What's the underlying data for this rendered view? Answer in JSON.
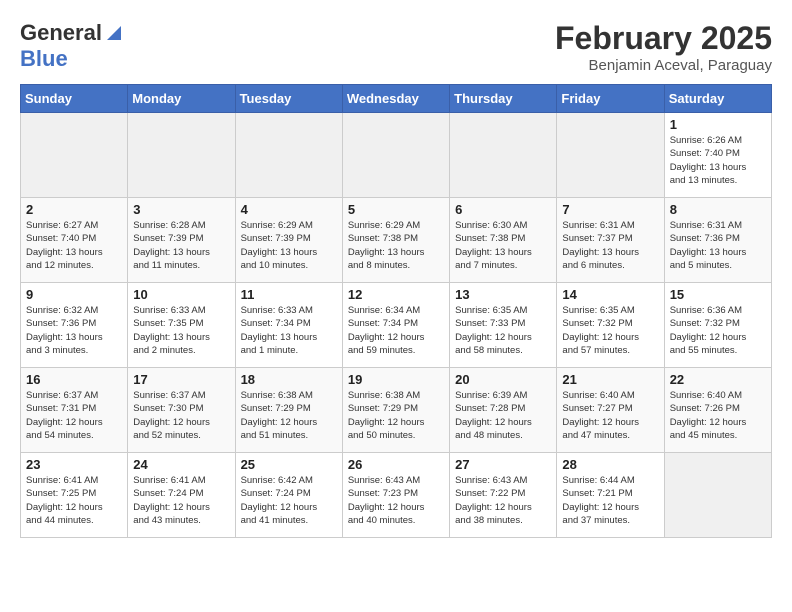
{
  "logo": {
    "general": "General",
    "blue": "Blue"
  },
  "title": {
    "month": "February 2025",
    "location": "Benjamin Aceval, Paraguay"
  },
  "days_of_week": [
    "Sunday",
    "Monday",
    "Tuesday",
    "Wednesday",
    "Thursday",
    "Friday",
    "Saturday"
  ],
  "weeks": [
    [
      {
        "day": "",
        "info": ""
      },
      {
        "day": "",
        "info": ""
      },
      {
        "day": "",
        "info": ""
      },
      {
        "day": "",
        "info": ""
      },
      {
        "day": "",
        "info": ""
      },
      {
        "day": "",
        "info": ""
      },
      {
        "day": "1",
        "info": "Sunrise: 6:26 AM\nSunset: 7:40 PM\nDaylight: 13 hours\nand 13 minutes."
      }
    ],
    [
      {
        "day": "2",
        "info": "Sunrise: 6:27 AM\nSunset: 7:40 PM\nDaylight: 13 hours\nand 12 minutes."
      },
      {
        "day": "3",
        "info": "Sunrise: 6:28 AM\nSunset: 7:39 PM\nDaylight: 13 hours\nand 11 minutes."
      },
      {
        "day": "4",
        "info": "Sunrise: 6:29 AM\nSunset: 7:39 PM\nDaylight: 13 hours\nand 10 minutes."
      },
      {
        "day": "5",
        "info": "Sunrise: 6:29 AM\nSunset: 7:38 PM\nDaylight: 13 hours\nand 8 minutes."
      },
      {
        "day": "6",
        "info": "Sunrise: 6:30 AM\nSunset: 7:38 PM\nDaylight: 13 hours\nand 7 minutes."
      },
      {
        "day": "7",
        "info": "Sunrise: 6:31 AM\nSunset: 7:37 PM\nDaylight: 13 hours\nand 6 minutes."
      },
      {
        "day": "8",
        "info": "Sunrise: 6:31 AM\nSunset: 7:36 PM\nDaylight: 13 hours\nand 5 minutes."
      }
    ],
    [
      {
        "day": "9",
        "info": "Sunrise: 6:32 AM\nSunset: 7:36 PM\nDaylight: 13 hours\nand 3 minutes."
      },
      {
        "day": "10",
        "info": "Sunrise: 6:33 AM\nSunset: 7:35 PM\nDaylight: 13 hours\nand 2 minutes."
      },
      {
        "day": "11",
        "info": "Sunrise: 6:33 AM\nSunset: 7:34 PM\nDaylight: 13 hours\nand 1 minute."
      },
      {
        "day": "12",
        "info": "Sunrise: 6:34 AM\nSunset: 7:34 PM\nDaylight: 12 hours\nand 59 minutes."
      },
      {
        "day": "13",
        "info": "Sunrise: 6:35 AM\nSunset: 7:33 PM\nDaylight: 12 hours\nand 58 minutes."
      },
      {
        "day": "14",
        "info": "Sunrise: 6:35 AM\nSunset: 7:32 PM\nDaylight: 12 hours\nand 57 minutes."
      },
      {
        "day": "15",
        "info": "Sunrise: 6:36 AM\nSunset: 7:32 PM\nDaylight: 12 hours\nand 55 minutes."
      }
    ],
    [
      {
        "day": "16",
        "info": "Sunrise: 6:37 AM\nSunset: 7:31 PM\nDaylight: 12 hours\nand 54 minutes."
      },
      {
        "day": "17",
        "info": "Sunrise: 6:37 AM\nSunset: 7:30 PM\nDaylight: 12 hours\nand 52 minutes."
      },
      {
        "day": "18",
        "info": "Sunrise: 6:38 AM\nSunset: 7:29 PM\nDaylight: 12 hours\nand 51 minutes."
      },
      {
        "day": "19",
        "info": "Sunrise: 6:38 AM\nSunset: 7:29 PM\nDaylight: 12 hours\nand 50 minutes."
      },
      {
        "day": "20",
        "info": "Sunrise: 6:39 AM\nSunset: 7:28 PM\nDaylight: 12 hours\nand 48 minutes."
      },
      {
        "day": "21",
        "info": "Sunrise: 6:40 AM\nSunset: 7:27 PM\nDaylight: 12 hours\nand 47 minutes."
      },
      {
        "day": "22",
        "info": "Sunrise: 6:40 AM\nSunset: 7:26 PM\nDaylight: 12 hours\nand 45 minutes."
      }
    ],
    [
      {
        "day": "23",
        "info": "Sunrise: 6:41 AM\nSunset: 7:25 PM\nDaylight: 12 hours\nand 44 minutes."
      },
      {
        "day": "24",
        "info": "Sunrise: 6:41 AM\nSunset: 7:24 PM\nDaylight: 12 hours\nand 43 minutes."
      },
      {
        "day": "25",
        "info": "Sunrise: 6:42 AM\nSunset: 7:24 PM\nDaylight: 12 hours\nand 41 minutes."
      },
      {
        "day": "26",
        "info": "Sunrise: 6:43 AM\nSunset: 7:23 PM\nDaylight: 12 hours\nand 40 minutes."
      },
      {
        "day": "27",
        "info": "Sunrise: 6:43 AM\nSunset: 7:22 PM\nDaylight: 12 hours\nand 38 minutes."
      },
      {
        "day": "28",
        "info": "Sunrise: 6:44 AM\nSunset: 7:21 PM\nDaylight: 12 hours\nand 37 minutes."
      },
      {
        "day": "",
        "info": ""
      }
    ]
  ]
}
